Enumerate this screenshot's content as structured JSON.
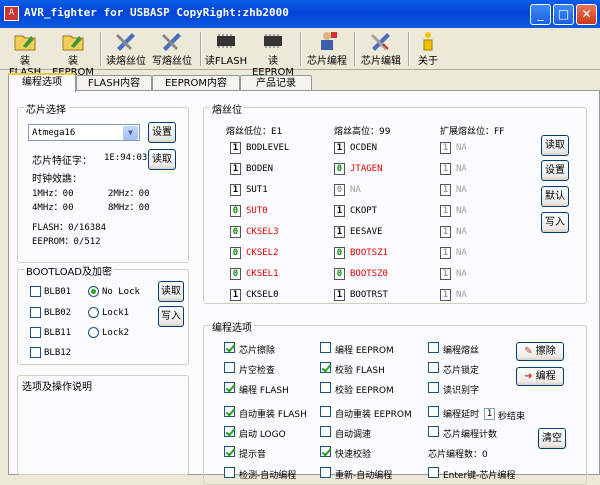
{
  "window": {
    "title": "AVR_fighter for USBASP CopyRight:zhb2000",
    "icon": "app-icon",
    "minimize": "_",
    "maximize": "□",
    "close": "✕"
  },
  "toolbar": [
    {
      "id": "load-flash",
      "label": "装FLASH",
      "icon": "folder-icon"
    },
    {
      "id": "load-eeprom",
      "label": "装EEPROM",
      "icon": "folder-icon"
    },
    {
      "id": "read-fuse",
      "label": "读熔丝位",
      "icon": "tools-icon"
    },
    {
      "id": "write-fuse",
      "label": "写熔丝位",
      "icon": "tools-icon"
    },
    {
      "id": "read-flash",
      "label": "读FLASH",
      "icon": "chip-icon"
    },
    {
      "id": "read-eeprom",
      "label": "读EEPROM",
      "icon": "chip-icon"
    },
    {
      "id": "program-chip",
      "label": "芯片编程",
      "icon": "person-icon"
    },
    {
      "id": "edit-chip",
      "label": "芯片编辑",
      "icon": "tools-icon"
    },
    {
      "id": "about",
      "label": "关于",
      "icon": "info-icon"
    }
  ],
  "tabs": [
    "编程选项",
    "FLASH内容",
    "EEPROM内容",
    "产品记录"
  ],
  "chip": {
    "group": "芯片选择",
    "selected": "Atmega16",
    "set_btn": "设置",
    "sig_label": "芯片特征字：",
    "sig_value": "1E:94:03",
    "read_btn": "读取",
    "clock_label": "时钟效譙：",
    "clock": [
      "1MHz：00",
      "2MHz：00",
      "4MHz：00",
      "8MHz：00"
    ],
    "flash": "FLASH：0/16384",
    "eeprom": "EEPROM：0/512"
  },
  "boot": {
    "group": "BOOTLOAD及加密",
    "items": [
      "BLB01",
      "BLB02",
      "BLB11",
      "BLB12"
    ],
    "lock": [
      "No Lock",
      "Lock1",
      "Lock2"
    ],
    "read_btn": "读取",
    "write_btn": "写入"
  },
  "info": {
    "group": "选项及操作说明"
  },
  "fuse": {
    "group": "熔丝位",
    "low": "熔丝低位：E1",
    "high": "熔丝高位：99",
    "ext": "扩展熔丝位：FF",
    "col1": [
      {
        "v": "1",
        "n": "BODLEVEL",
        "c": "n"
      },
      {
        "v": "1",
        "n": "BODEN",
        "c": "n"
      },
      {
        "v": "1",
        "n": "SUT1",
        "c": "n"
      },
      {
        "v": "0",
        "n": "SUT0",
        "c": "r"
      },
      {
        "v": "0",
        "n": "CKSEL3",
        "c": "r"
      },
      {
        "v": "0",
        "n": "CKSEL2",
        "c": "r"
      },
      {
        "v": "0",
        "n": "CKSEL1",
        "c": "r"
      },
      {
        "v": "1",
        "n": "CKSEL0",
        "c": "n"
      }
    ],
    "col2": [
      {
        "v": "1",
        "n": "OCDEN",
        "c": "n"
      },
      {
        "v": "0",
        "n": "JTAGEN",
        "c": "r"
      },
      {
        "v": "0",
        "n": "NA",
        "c": "g"
      },
      {
        "v": "1",
        "n": "CKOPT",
        "c": "n"
      },
      {
        "v": "1",
        "n": "EESAVE",
        "c": "n"
      },
      {
        "v": "0",
        "n": "BOOTSZ1",
        "c": "r"
      },
      {
        "v": "0",
        "n": "BOOTSZ0",
        "c": "r"
      },
      {
        "v": "1",
        "n": "BOOTRST",
        "c": "n"
      }
    ],
    "col3": [
      {
        "v": "1",
        "n": "NA",
        "c": "g"
      },
      {
        "v": "1",
        "n": "NA",
        "c": "g"
      },
      {
        "v": "1",
        "n": "NA",
        "c": "g"
      },
      {
        "v": "1",
        "n": "NA",
        "c": "g"
      },
      {
        "v": "1",
        "n": "NA",
        "c": "g"
      },
      {
        "v": "1",
        "n": "NA",
        "c": "g"
      },
      {
        "v": "1",
        "n": "NA",
        "c": "g"
      },
      {
        "v": "1",
        "n": "NA",
        "c": "g"
      }
    ],
    "buttons": [
      "读取",
      "设置",
      "默认",
      "写入"
    ]
  },
  "prog": {
    "group": "编程选项",
    "rows": [
      [
        {
          "t": "芯片擦除",
          "on": true
        },
        {
          "t": "编程 EEPROM",
          "on": false
        },
        {
          "t": "编程熔丝",
          "on": false
        }
      ],
      [
        {
          "t": "片空检查",
          "on": false
        },
        {
          "t": "校验 FLASH",
          "on": true
        },
        {
          "t": "芯片锁定",
          "on": false
        }
      ],
      [
        {
          "t": "编程 FLASH",
          "on": true
        },
        {
          "t": "校验 EEPROM",
          "on": false
        },
        {
          "t": "读识别字",
          "on": false
        }
      ],
      [
        {
          "t": "自动重装 FLASH",
          "on": true
        },
        {
          "t": "自动重装 EEPROM",
          "on": false
        },
        {
          "t": "编程延时",
          "on": false
        }
      ],
      [
        {
          "t": "启动 LOGO",
          "on": true
        },
        {
          "t": "自动调速",
          "on": false
        },
        {
          "t": "芯片编程计数",
          "on": false
        }
      ],
      [
        {
          "t": "提示音",
          "on": true
        },
        {
          "t": "快速校验",
          "on": true
        },
        {
          "t": "芯片编程数：0",
          "on": null
        }
      ],
      [
        {
          "t": "检测-自动编程",
          "on": false
        },
        {
          "t": "重新-自动编程",
          "on": false
        },
        {
          "t": "Enter键-芯片编程",
          "on": false
        }
      ]
    ],
    "delay_value": "1",
    "delay_suffix": "秒结束",
    "erase_btn": "擦除",
    "program_btn": "编程",
    "clear_btn": "清空"
  }
}
